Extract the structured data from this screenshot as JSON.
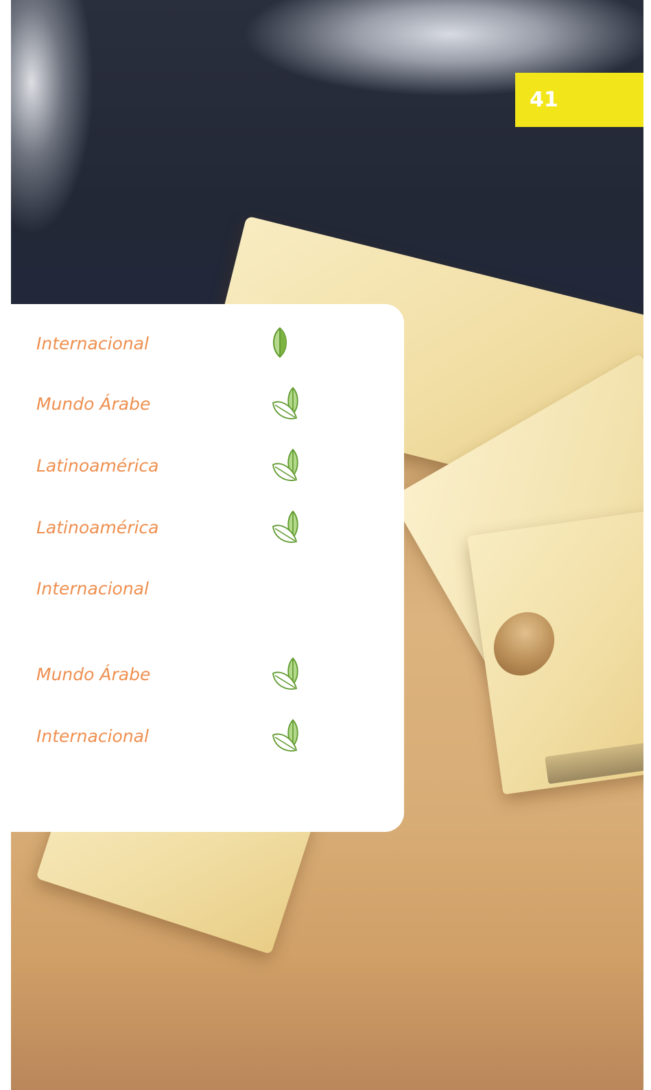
{
  "page": {
    "number": "41",
    "badge_color": "#f2e61a"
  },
  "list": {
    "text_color": "#ef8f4f",
    "icon_color": "#7cb342",
    "rows": [
      {
        "label": "Internacional",
        "icon": "single-leaf-icon"
      },
      {
        "label": "Mundo Árabe",
        "icon": "double-leaf-icon"
      },
      {
        "label": "Latinoamérica",
        "icon": "double-leaf-icon"
      },
      {
        "label": "Latinoamérica",
        "icon": "double-leaf-icon"
      },
      {
        "label": "Internacional",
        "icon": ""
      },
      {
        "label": "Mundo Árabe",
        "icon": "double-leaf-icon"
      },
      {
        "label": "Internacional",
        "icon": "double-leaf-icon"
      }
    ]
  },
  "background": {
    "subject": "cheese-photo"
  }
}
